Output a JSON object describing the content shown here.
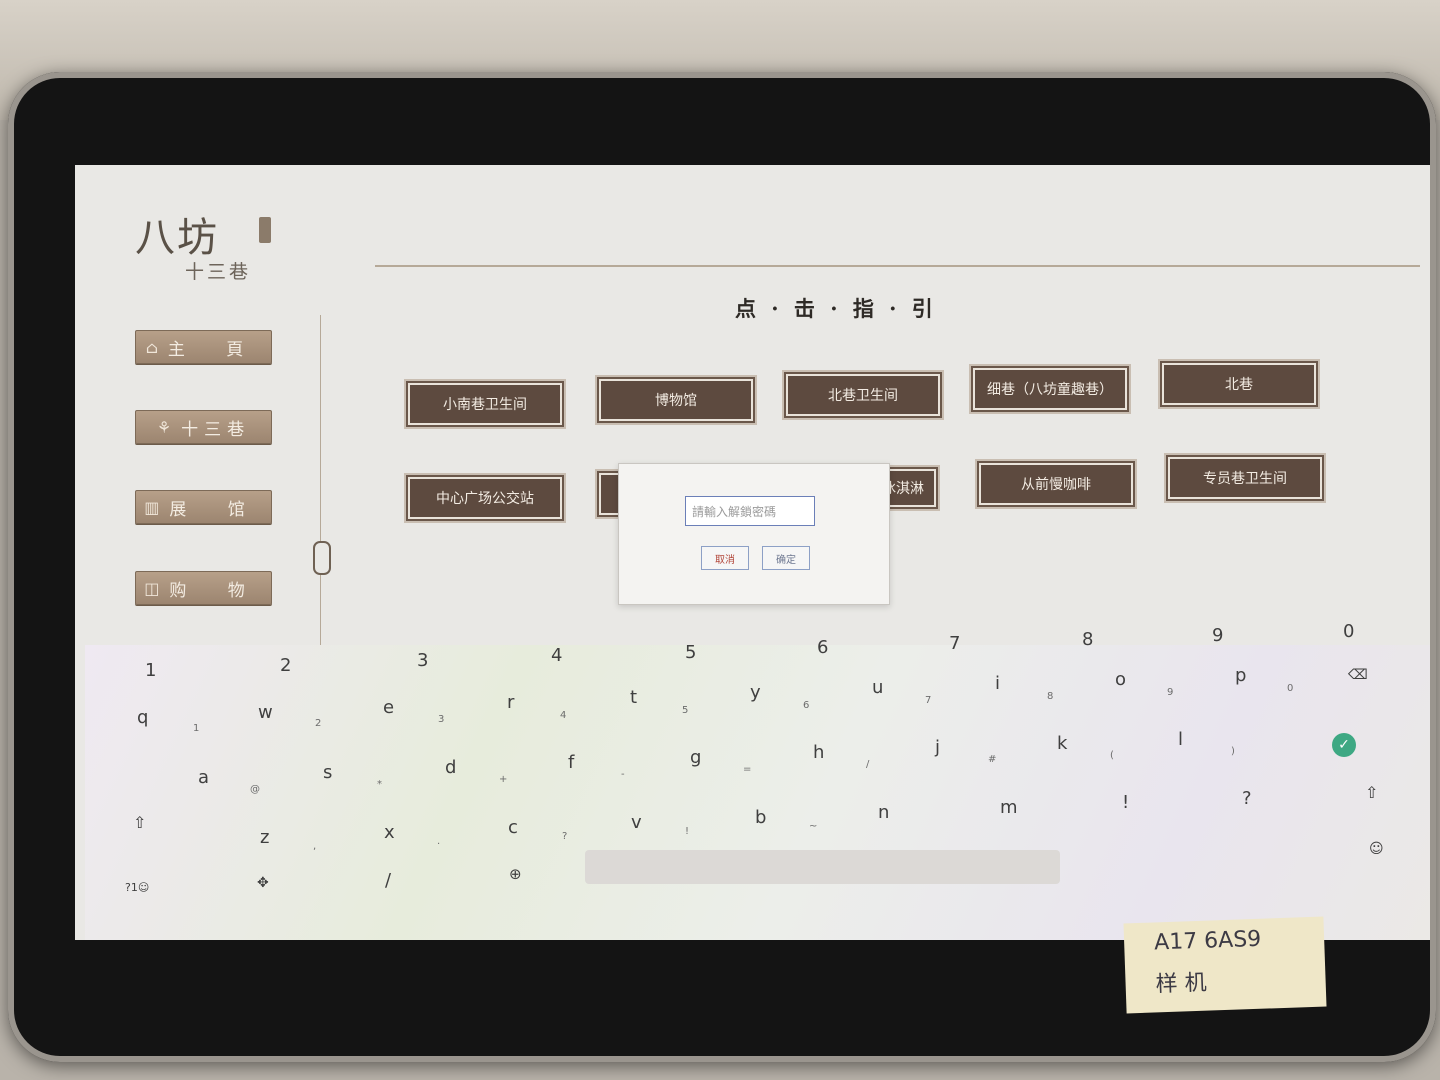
{
  "logo": {
    "main": "八坊",
    "sub": "十三巷"
  },
  "sidebar": {
    "items": [
      {
        "label": "主 頁",
        "icon": "home-icon",
        "glyph": "⌂"
      },
      {
        "label": "十三巷",
        "icon": "lane-icon",
        "glyph": "⚘"
      },
      {
        "label": "展 馆",
        "icon": "museum-icon",
        "glyph": "▥"
      },
      {
        "label": "购 物",
        "icon": "shopping-bag-icon",
        "glyph": "◫"
      }
    ]
  },
  "main": {
    "title": "点 · 击 · 指 · 引",
    "locations_row1": [
      "小南巷卫生间",
      "博物馆",
      "北巷卫生间",
      "细巷（八坊童趣巷）",
      "北巷"
    ],
    "locations_row2": [
      "中心广场公交站",
      "",
      "冰淇淋",
      "从前慢咖啡",
      "专员巷卫生间"
    ]
  },
  "dialog": {
    "placeholder": "請輸入解鎖密碼",
    "cancel_label": "取消",
    "ok_label": "确定"
  },
  "keyboard": {
    "numbers": [
      "1",
      "2",
      "3",
      "4",
      "5",
      "6",
      "7",
      "8",
      "9",
      "0"
    ],
    "row1": [
      "q",
      "w",
      "e",
      "r",
      "t",
      "y",
      "u",
      "i",
      "o",
      "p"
    ],
    "row1_sub": [
      "1",
      "2",
      "3",
      "4",
      "5",
      "6",
      "7",
      "8",
      "9",
      "0"
    ],
    "row2": [
      "a",
      "s",
      "d",
      "f",
      "g",
      "h",
      "j",
      "k",
      "l"
    ],
    "row2_sub": [
      "@",
      "*",
      "+",
      "-",
      "=",
      "/",
      "#",
      "(",
      ")"
    ],
    "row3": [
      "z",
      "x",
      "c",
      "v",
      "b",
      "n",
      "m",
      "!",
      "?"
    ],
    "row3_sub": [
      ",",
      ".",
      "?",
      "!",
      "~"
    ],
    "symbols_label": "?1☺",
    "slash_label": "/",
    "accent_color": "#3ea883"
  },
  "sticker": {
    "line1": "A17   6AS9",
    "line2": "样     机"
  }
}
